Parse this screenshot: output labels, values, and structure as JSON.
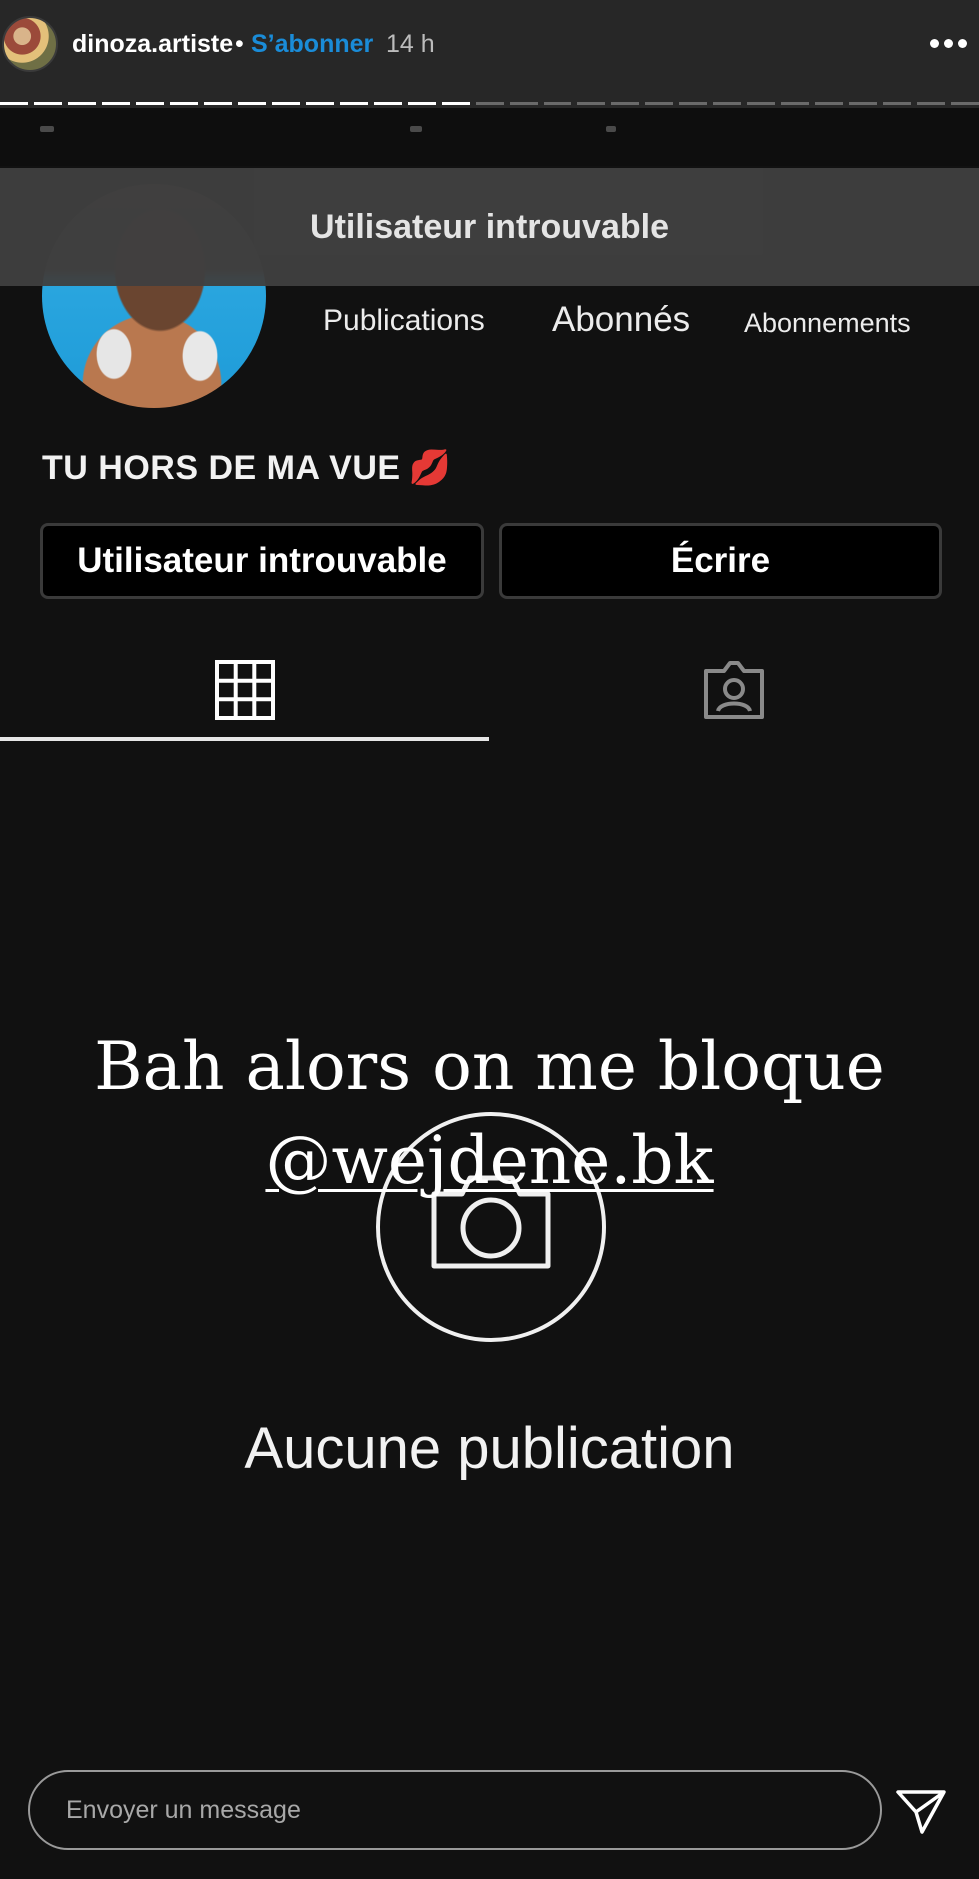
{
  "story_header": {
    "username": "dinoza.artiste",
    "separator": "•",
    "follow_label": "S’abonner",
    "time": "14 h",
    "progress_segments": 29,
    "progress_done": 14
  },
  "banner": {
    "text": "Utilisateur introuvable"
  },
  "profile": {
    "stats": [
      "Publications",
      "Abonnés",
      "Abonnements"
    ],
    "bio": "TU HORS DE MA VUE",
    "bio_emoji": "💋",
    "buttons": {
      "primary": "Utilisateur introuvable",
      "message": "Écrire"
    }
  },
  "tabs": {
    "active": "grid-icon",
    "items": [
      "grid-icon",
      "tagged-icon"
    ]
  },
  "story_caption": {
    "line1": "Bah alors on me bloque",
    "mention": "@wejdene.bk"
  },
  "empty_state": {
    "icon": "camera-icon",
    "text": "Aucune publication"
  },
  "message_bar": {
    "placeholder": "Envoyer un message",
    "send_icon": "send-icon"
  },
  "colors": {
    "follow_link": "#1a8cd8",
    "background": "#111111",
    "header": "#272727",
    "lips": "#d42135"
  }
}
